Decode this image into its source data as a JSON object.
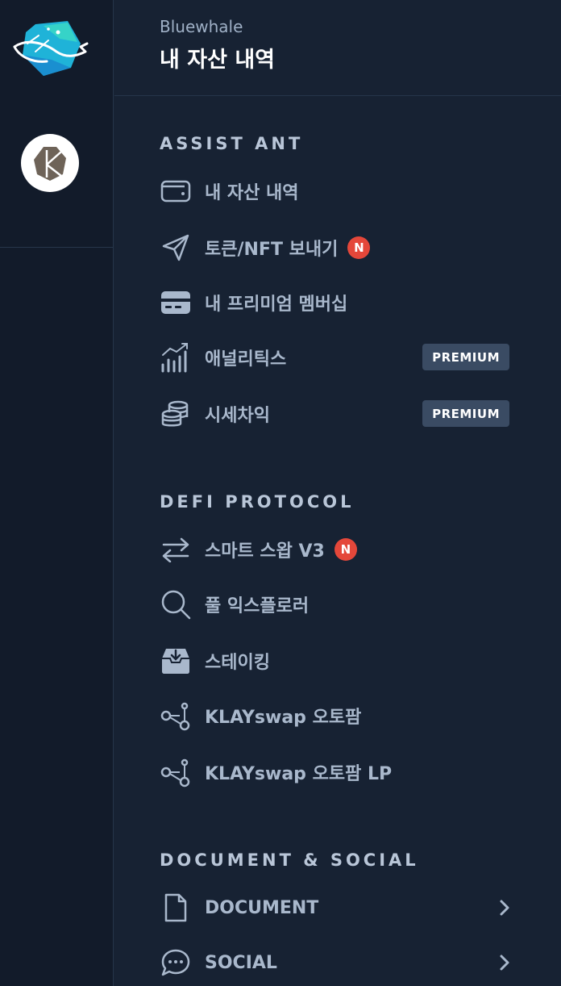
{
  "header": {
    "brand": "Bluewhale",
    "title": "내 자산 내역"
  },
  "rail": {
    "logo_icon": "bluewhale-logo",
    "chain_icon": "klaytn-logo"
  },
  "sections": [
    {
      "title": "ASSIST ANT",
      "items": [
        {
          "label": "내 자산 내역",
          "icon": "wallet-icon"
        },
        {
          "label": "토큰/NFT 보내기",
          "icon": "send-icon",
          "badge": "N"
        },
        {
          "label": "내 프리미엄 멤버십",
          "icon": "credit-card-icon"
        },
        {
          "label": "애널리틱스",
          "icon": "analytics-icon",
          "tag": "PREMIUM"
        },
        {
          "label": "시세차익",
          "icon": "coins-icon",
          "tag": "PREMIUM"
        }
      ]
    },
    {
      "title": "DEFI PROTOCOL",
      "items": [
        {
          "label": "스마트 스왑 V3",
          "icon": "swap-arrows-icon",
          "badge": "N"
        },
        {
          "label": "풀 익스플로러",
          "icon": "search-icon"
        },
        {
          "label": "스테이킹",
          "icon": "inbox-download-icon"
        },
        {
          "label": "KLAYswap 오토팜",
          "icon": "share-nodes-icon"
        },
        {
          "label": "KLAYswap 오토팜 LP",
          "icon": "share-nodes-icon"
        }
      ]
    },
    {
      "title": "DOCUMENT & SOCIAL",
      "items": [
        {
          "label": "DOCUMENT",
          "icon": "document-icon"
        },
        {
          "label": "SOCIAL",
          "icon": "chat-bubble-icon"
        }
      ]
    }
  ]
}
